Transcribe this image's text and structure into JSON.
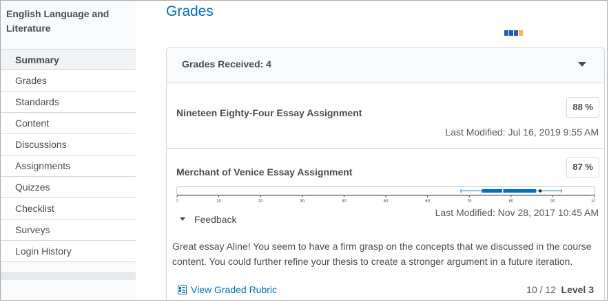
{
  "sidebar": {
    "course_title": "English Language and Literature",
    "items": [
      {
        "label": "Summary",
        "active": true
      },
      {
        "label": "Grades"
      },
      {
        "label": "Standards"
      },
      {
        "label": "Content"
      },
      {
        "label": "Discussions"
      },
      {
        "label": "Assignments"
      },
      {
        "label": "Quizzes"
      },
      {
        "label": "Checklist"
      },
      {
        "label": "Surveys"
      },
      {
        "label": "Login History"
      }
    ]
  },
  "main": {
    "title": "Grades",
    "loader_colors": [
      "#1c5eb0",
      "#1c5eb0",
      "#1c5eb0",
      "#f5b84a"
    ],
    "card": {
      "header": "Grades Received: 4",
      "items": [
        {
          "name": "Nineteen Eighty-Four Essay Assignment",
          "score": "88 %",
          "last_modified": "Last Modified: Jul 16, 2019 9:55 AM"
        },
        {
          "name": "Merchant of Venice Essay Assignment",
          "score": "87 %",
          "last_modified": "Last Modified: Nov 28, 2017 10:45 AM",
          "feedback_label": "Feedback",
          "feedback_text": "Great essay Aline! You seem to have a firm grasp on the concepts that we discussed in the course content. You could further refine your thesis to create a stronger argument in a future iteration.",
          "rubric_link": "View Graded Rubric",
          "rubric_score": "10 / 12",
          "rubric_level": "Level 3"
        }
      ]
    }
  },
  "chart_data": {
    "type": "boxplot",
    "xlim": [
      0,
      100
    ],
    "ticks": [
      "0",
      "10",
      "20",
      "30",
      "40",
      "50",
      "60",
      "70",
      "80",
      "90",
      "100"
    ],
    "min": 68,
    "q1": 73,
    "median": 78,
    "q3": 86,
    "max": 92,
    "marker": 87,
    "colors": {
      "box": "#006fbf",
      "whisker": "#006fbf",
      "marker": "#222222"
    }
  }
}
